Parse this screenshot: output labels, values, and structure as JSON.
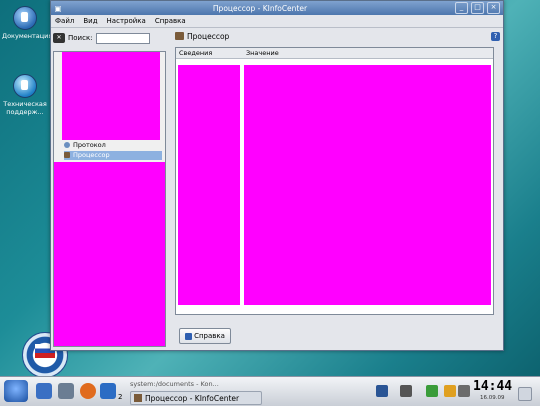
{
  "desktop": {
    "icons": [
      {
        "label": "Документация",
        "icon": "documentation-icon"
      },
      {
        "label": "Техническая поддерж...",
        "icon": "support-icon"
      }
    ]
  },
  "window": {
    "title": "Процессор - KInfoCenter",
    "menu": [
      "Файл",
      "Вид",
      "Настройка",
      "Справка"
    ],
    "search_label": "Поиск:",
    "tree": {
      "items": [
        {
          "label": "Протокол"
        },
        {
          "label": "Процессор",
          "selected": true
        }
      ]
    },
    "panel": {
      "title": "Процессор",
      "columns": [
        "Сведения",
        "Значение"
      ]
    },
    "help_button": "Справка"
  },
  "taskbar": {
    "task_inactive": "system:/documents - Kon...",
    "task_active": "Процессор - KInfoCenter",
    "desktop_number": "2",
    "clock": "14:44",
    "date": "16.09.09"
  },
  "colors": {
    "accent": "#4d76ad",
    "redaction": "#ff00ff"
  }
}
